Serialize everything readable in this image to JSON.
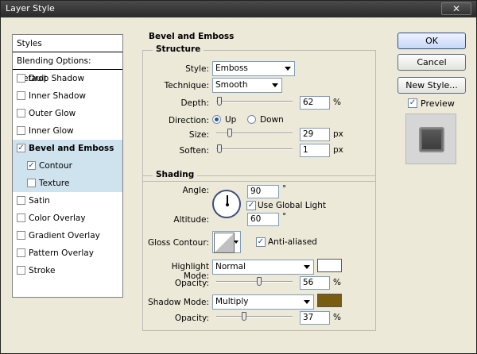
{
  "window": {
    "title": "Layer Style",
    "close_glyph": "✕"
  },
  "styles_panel": {
    "header": "Styles",
    "blending_options": "Blending Options: Default",
    "items": [
      {
        "label": "Drop Shadow",
        "checked": false
      },
      {
        "label": "Inner Shadow",
        "checked": false
      },
      {
        "label": "Outer Glow",
        "checked": false
      },
      {
        "label": "Inner Glow",
        "checked": false
      },
      {
        "label": "Bevel and Emboss",
        "checked": true,
        "selected": true
      },
      {
        "label": "Contour",
        "checked": true,
        "sub": true
      },
      {
        "label": "Texture",
        "checked": false,
        "sub": true
      },
      {
        "label": "Satin",
        "checked": false
      },
      {
        "label": "Color Overlay",
        "checked": false
      },
      {
        "label": "Gradient Overlay",
        "checked": false
      },
      {
        "label": "Pattern Overlay",
        "checked": false
      },
      {
        "label": "Stroke",
        "checked": false
      }
    ]
  },
  "bevel": {
    "title": "Bevel and Emboss",
    "structure": {
      "title": "Structure",
      "style_label": "Style:",
      "style_value": "Emboss",
      "technique_label": "Technique:",
      "technique_value": "Smooth",
      "depth_label": "Depth:",
      "depth_value": "62",
      "depth_unit": "%",
      "direction_label": "Direction:",
      "dir_up": "Up",
      "dir_down": "Down",
      "size_label": "Size:",
      "size_value": "29",
      "size_unit": "px",
      "soften_label": "Soften:",
      "soften_value": "1",
      "soften_unit": "px"
    },
    "shading": {
      "title": "Shading",
      "angle_label": "Angle:",
      "angle_value": "90",
      "angle_unit": "°",
      "global_light": "Use Global Light",
      "altitude_label": "Altitude:",
      "altitude_value": "60",
      "altitude_unit": "°",
      "gloss_label": "Gloss Contour:",
      "anti_aliased": "Anti-aliased",
      "highlight_label": "Highlight Mode:",
      "highlight_value": "Normal",
      "highlight_color": "#ffffff",
      "opacity_label": "Opacity:",
      "highlight_opacity": "56",
      "opacity_unit": "%",
      "shadow_label": "Shadow Mode:",
      "shadow_value": "Multiply",
      "shadow_color": "#7a5c10",
      "shadow_opacity_label": "Opacity:",
      "shadow_opacity": "37"
    }
  },
  "buttons": {
    "ok": "OK",
    "cancel": "Cancel",
    "new_style": "New Style...",
    "preview": "Preview"
  },
  "colors": {
    "selection": "#cfe3ee",
    "dialog_bg": "#ece9d8"
  }
}
